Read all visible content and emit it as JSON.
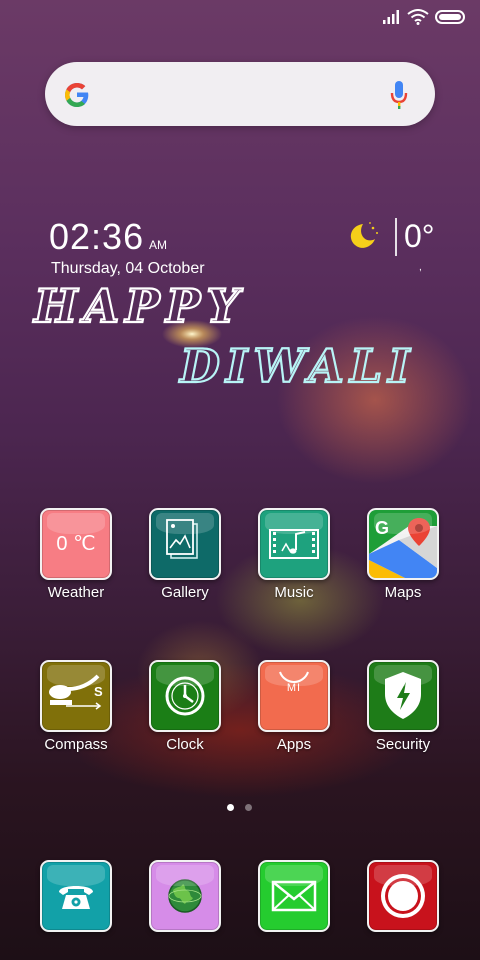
{
  "status_bar": {
    "icons": [
      "signal-icon",
      "wifi-icon",
      "battery-icon"
    ]
  },
  "search": {
    "placeholder": "",
    "icons": [
      "google-logo-icon",
      "microphone-icon"
    ]
  },
  "clock": {
    "time": "02:36",
    "ampm": "AM",
    "date": "Thursday, 04 October"
  },
  "weather": {
    "icon": "moon-stars-icon",
    "temperature": "0°",
    "sub": ","
  },
  "greeting": {
    "line1": "HAPPY",
    "line2": "DIWALI"
  },
  "apps_row1": [
    {
      "label": "Weather",
      "icon_text": "0 ℃",
      "color": "#f77d84",
      "icon": "weather-icon"
    },
    {
      "label": "Gallery",
      "color": "#0e6a68",
      "icon": "gallery-icon"
    },
    {
      "label": "Music",
      "color": "#1ea27e",
      "icon": "music-icon"
    },
    {
      "label": "Maps",
      "color": "#1e9e38",
      "icon": "maps-icon"
    }
  ],
  "apps_row2": [
    {
      "label": "Compass",
      "color": "#80700a",
      "icon": "compass-icon"
    },
    {
      "label": "Clock",
      "color": "#1b7e16",
      "icon": "clock-icon"
    },
    {
      "label": "Apps",
      "color": "#f26b4e",
      "icon_text": "MI",
      "icon": "app-store-icon"
    },
    {
      "label": "Security",
      "color": "#1e7c18",
      "icon": "security-shield-icon"
    }
  ],
  "page_indicator": {
    "count": 2,
    "active": 1
  },
  "dock": [
    {
      "name": "phone",
      "color": "#12a1a8",
      "icon": "phone-icon"
    },
    {
      "name": "browser",
      "color": "#d68ce8",
      "icon": "globe-icon"
    },
    {
      "name": "messages",
      "color": "#25cc2f",
      "icon": "envelope-icon"
    },
    {
      "name": "camera",
      "color": "#c8121c",
      "icon": "camera-shutter-icon"
    }
  ]
}
